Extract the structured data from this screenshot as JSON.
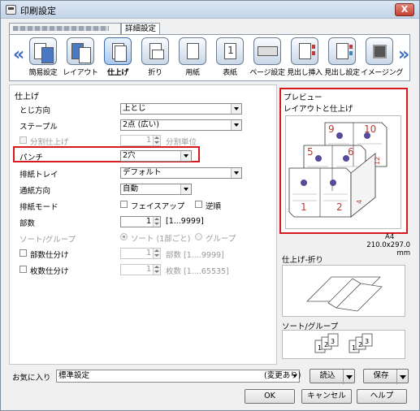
{
  "window": {
    "title": "印刷設定",
    "close": "X"
  },
  "tabs": [
    {
      "label": ""
    },
    {
      "label": "詳細設定"
    }
  ],
  "ribbon": {
    "left_arrow": "«",
    "right_arrow": "»",
    "items": [
      {
        "label": "簡易設定",
        "icon": "quick-setup-icon"
      },
      {
        "label": "レイアウト",
        "icon": "layout-icon"
      },
      {
        "label": "仕上げ",
        "icon": "finishing-icon",
        "selected": true
      },
      {
        "label": "折り",
        "icon": "fold-icon"
      },
      {
        "label": "用紙",
        "icon": "paper-icon"
      },
      {
        "label": "表紙",
        "icon": "cover-icon"
      },
      {
        "label": "ページ設定",
        "icon": "page-setup-icon"
      },
      {
        "label": "見出し挿入",
        "icon": "tab-insert-icon"
      },
      {
        "label": "見出し設定",
        "icon": "tab-settings-icon"
      },
      {
        "label": "イメージング",
        "icon": "imaging-icon"
      }
    ]
  },
  "finishing": {
    "group_title": "仕上げ",
    "binding_label": "とじ方向",
    "binding_value": "上とじ",
    "staple_label": "ステープル",
    "staple_value": "2点 (広い)",
    "split_label": "分割仕上げ",
    "split_count": "1",
    "split_unit": "分割単位",
    "punch_label": "パンチ",
    "punch_value": "2穴",
    "output_tray_label": "排紙トレイ",
    "output_tray_value": "デフォルト",
    "paper_path_label": "通紙方向",
    "paper_path_value": "自動",
    "output_mode_label": "排紙モード",
    "face_up_label": "フェイスアップ",
    "reverse_label": "逆順",
    "copies_label": "部数",
    "copies_value": "1",
    "copies_range": "[1...9999]",
    "sort_group_label": "ソート/グループ",
    "sort_label": "ソート (1部ごと)",
    "group_label": "グループ",
    "set_split_label": "部数仕分け",
    "set_split_value": "1",
    "set_split_unit": "部数 [1....9999]",
    "sheet_split_label": "枚数仕分け",
    "sheet_split_value": "1",
    "sheet_split_unit": "枚数 [1....65535]"
  },
  "preview": {
    "title": "プレビュー",
    "subtitle": "レイアウトと仕上げ",
    "page_numbers": [
      "9",
      "10",
      "5",
      "6",
      "1",
      "2",
      "12",
      "4"
    ],
    "paper_name": "A4",
    "paper_dims": "210.0x297.0 mm",
    "fold_title": "仕上げ-折り",
    "sort_title": "ソート/グループ",
    "sort_stack_numbers": [
      "1",
      "2",
      "3"
    ]
  },
  "footer": {
    "favorites_label": "お気に入り",
    "favorites_value": "標準設定",
    "changed_text": "(変更あり)",
    "load_label": "読込",
    "save_label": "保存",
    "ok_label": "OK",
    "cancel_label": "キャンセル",
    "help_label": "ヘルプ"
  },
  "colors": {
    "highlight": "#d71920",
    "accent": "#3b6cc4"
  }
}
